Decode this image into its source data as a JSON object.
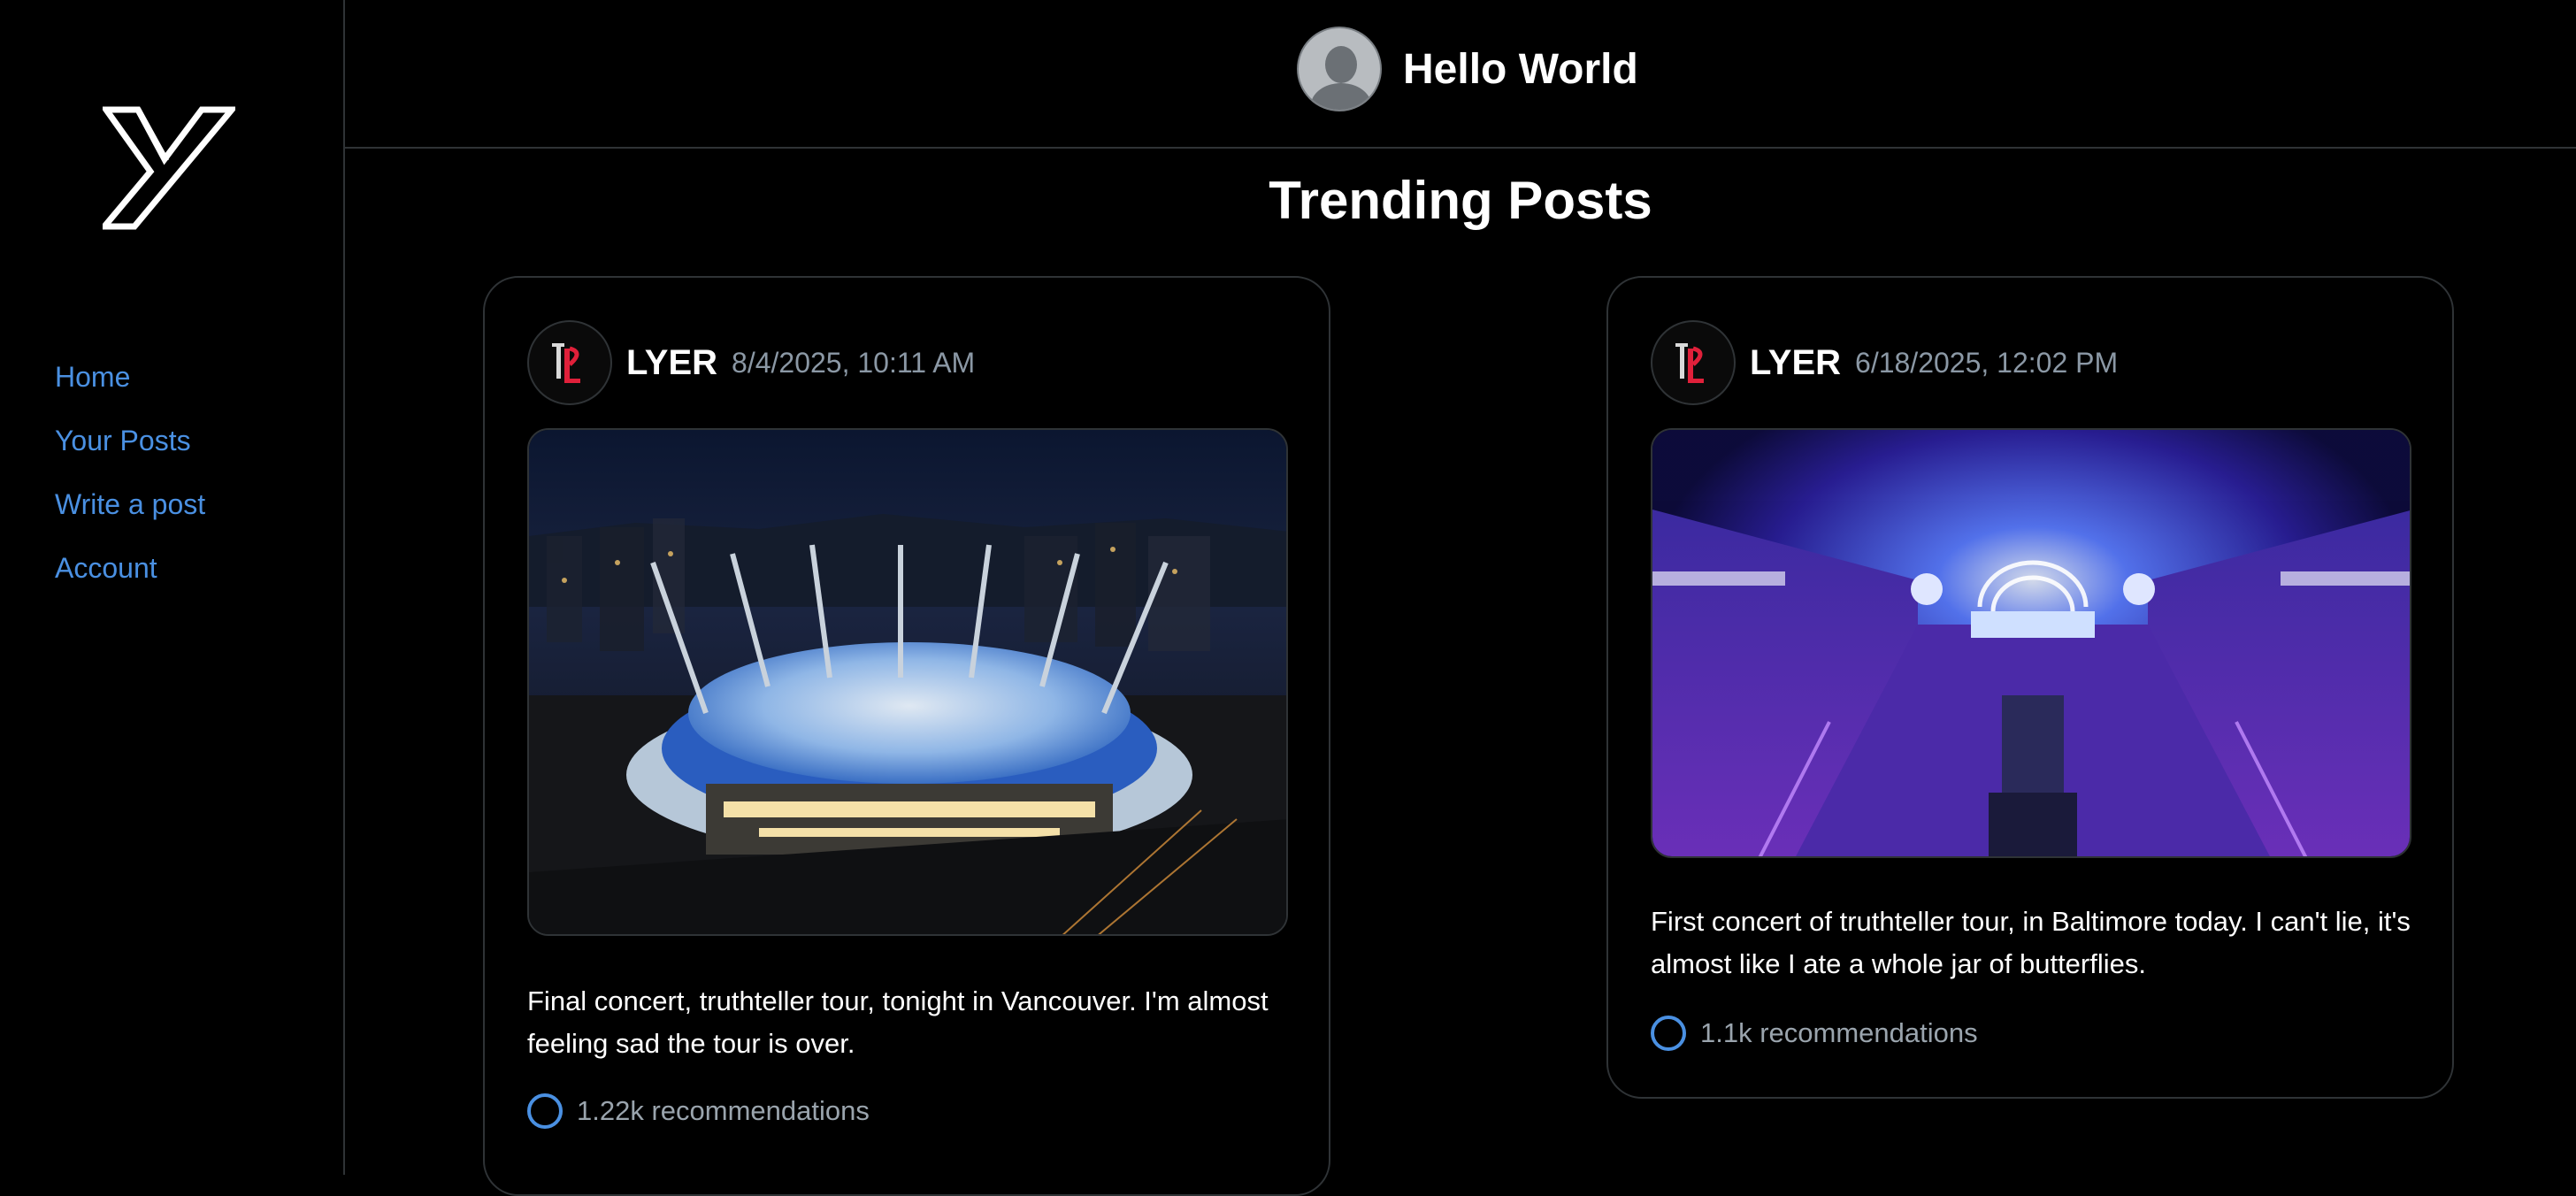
{
  "sidebar": {
    "logo": "Y",
    "nav": [
      {
        "label": "Home"
      },
      {
        "label": "Your Posts"
      },
      {
        "label": "Write a post"
      },
      {
        "label": "Account"
      }
    ]
  },
  "header": {
    "user_name": "Hello World"
  },
  "page_title": "Trending Posts",
  "posts": [
    {
      "author": "LYER",
      "timestamp": "8/4/2025, 10:11 AM",
      "image": "stadium-night-photo",
      "text": "Final concert, truthteller tour, tonight in Vancouver. I'm almost feeling sad the tour is over.",
      "recommendations": "1.22k recommendations"
    },
    {
      "author": "LYER",
      "timestamp": "6/18/2025, 12:02 PM",
      "image": "arena-concert-photo",
      "text": "First concert of truthteller tour, in Baltimore today. I can't lie, it's almost like I ate a whole jar of butterflies.",
      "recommendations": "1.1k recommendations"
    }
  ],
  "colors": {
    "background": "#000000",
    "accent": "#4a90e2",
    "border": "#2f3336",
    "muted_text": "#8b98a5"
  }
}
